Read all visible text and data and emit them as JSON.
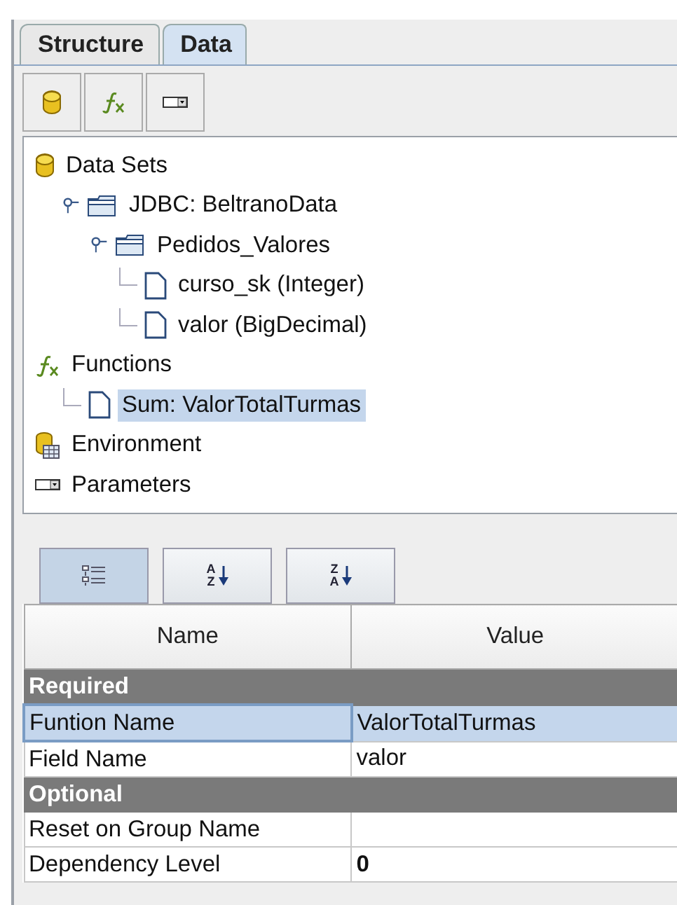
{
  "tabs": [
    {
      "label": "Structure",
      "selected": false
    },
    {
      "label": "Data",
      "selected": true
    }
  ],
  "toolbar": [
    {
      "kind": "database"
    },
    {
      "kind": "function"
    },
    {
      "kind": "parameter"
    }
  ],
  "tree": [
    {
      "label": "Data Sets",
      "kind": "database",
      "selected": false,
      "children": [
        {
          "label": "JDBC: BeltranoData",
          "kind": "folder",
          "selected": false,
          "expanded": true,
          "children": [
            {
              "label": "Pedidos_Valores",
              "kind": "folder",
              "selected": false,
              "expanded": true,
              "children": [
                {
                  "label": "curso_sk (Integer)",
                  "kind": "file",
                  "selected": false
                },
                {
                  "label": "valor (BigDecimal)",
                  "kind": "file",
                  "selected": false
                }
              ]
            }
          ]
        }
      ]
    },
    {
      "label": "Functions",
      "kind": "function",
      "selected": false,
      "children": [
        {
          "label": "Sum: ValorTotalTurmas",
          "kind": "file",
          "selected": true
        }
      ]
    },
    {
      "label": "Environment",
      "kind": "environment",
      "selected": false
    },
    {
      "label": "Parameters",
      "kind": "parameter",
      "selected": false
    }
  ],
  "sort_buttons": [
    {
      "kind": "categorized",
      "selected": true
    },
    {
      "kind": "ascending",
      "top": "A",
      "bottom": "Z",
      "selected": false
    },
    {
      "kind": "descending",
      "top": "Z",
      "bottom": "A",
      "selected": false
    }
  ],
  "table": {
    "columns": [
      "Name",
      "Value"
    ],
    "rows": [
      {
        "kind": "category",
        "name": "Required"
      },
      {
        "kind": "property",
        "name": "Funtion Name",
        "value": "ValorTotalTurmas",
        "selected": true
      },
      {
        "kind": "property",
        "name": "Field Name",
        "value": "valor",
        "selected": false
      },
      {
        "kind": "category",
        "name": "Optional"
      },
      {
        "kind": "property",
        "name": "Reset on Group Name",
        "selected": false
      },
      {
        "kind": "property",
        "name": "Dependency Level",
        "value": "0",
        "bold_value": true,
        "selected": false
      }
    ]
  }
}
